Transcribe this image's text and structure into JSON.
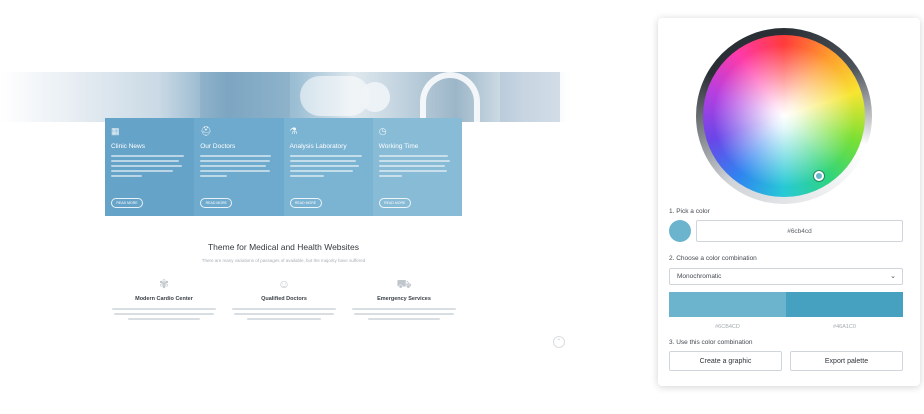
{
  "website": {
    "cards": [
      {
        "icon": "clinic-icon",
        "title": "Clinic News",
        "button": "READ MORE",
        "color": "#66a3c8"
      },
      {
        "icon": "doctor-icon",
        "title": "Our Doctors",
        "button": "READ MORE",
        "color": "#6eaacd"
      },
      {
        "icon": "lab-icon",
        "title": "Analysis Laboratory",
        "button": "READ MORE",
        "color": "#7bb3d2"
      },
      {
        "icon": "clock-icon",
        "title": "Working Time",
        "button": "READ MORE",
        "color": "#87bbd6"
      }
    ],
    "section_title": "Theme for Medical and Health Websites",
    "section_subtitle": "There are many variations of passages of available, but the majority have suffered",
    "features": [
      {
        "icon": "heart-icon",
        "title": "Modern Cardio Center"
      },
      {
        "icon": "doctor-avatar-icon",
        "title": "Qualified Doctors"
      },
      {
        "icon": "ambulance-icon",
        "title": "Emergency Services"
      }
    ]
  },
  "picker": {
    "step1_label": "1. Pick a color",
    "hex_value": "#6cb4cd",
    "selected_color": "#6cb4cd",
    "step2_label": "2. Choose a color combination",
    "combination": "Monochromatic",
    "combo_colors": [
      {
        "hex": "#6cb4cd",
        "label": "#6CB4CD"
      },
      {
        "hex": "#46a1c0",
        "label": "#46A1C0"
      }
    ],
    "step3_label": "3. Use this color combination",
    "create_button": "Create a graphic",
    "export_button": "Export palette"
  }
}
